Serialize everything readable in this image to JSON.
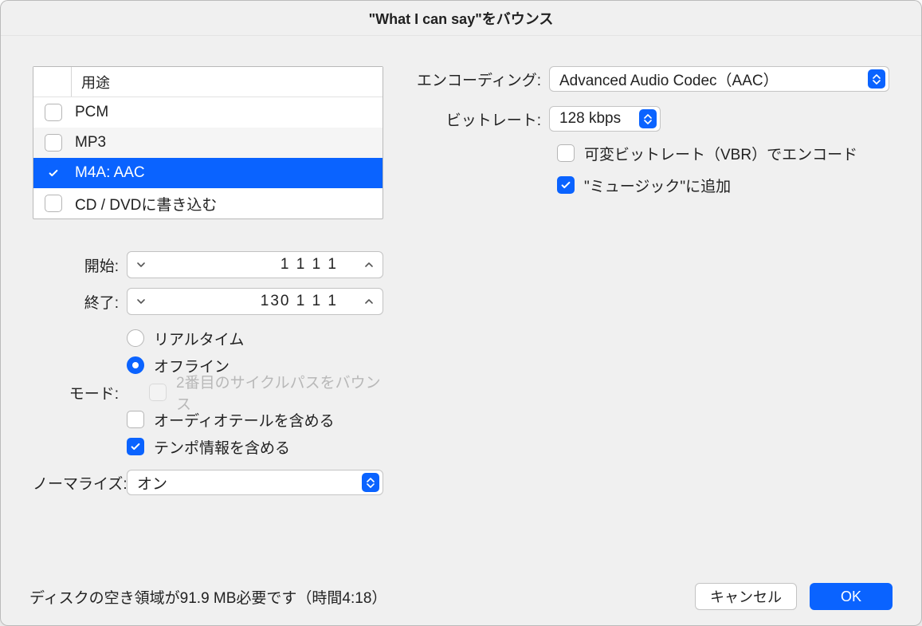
{
  "title": "\"What I can say\"をバウンス",
  "format_list": {
    "header": "用途",
    "items": [
      {
        "label": "PCM",
        "checked": false
      },
      {
        "label": "MP3",
        "checked": false
      },
      {
        "label": "M4A: AAC",
        "checked": true,
        "selected": true
      },
      {
        "label": "CD / DVDに書き込む",
        "checked": false
      }
    ]
  },
  "range": {
    "start_label": "開始:",
    "end_label": "終了:",
    "start_value": "1  1  1      1",
    "end_value": "130  1  1      1"
  },
  "mode": {
    "label": "モード:",
    "realtime": "リアルタイム",
    "offline": "オフライン",
    "second_pass": "2番目のサイクルパスをバウンス",
    "include_tail": "オーディオテールを含める",
    "include_tempo": "テンポ情報を含める",
    "selected": "offline",
    "include_tempo_checked": true,
    "include_tail_checked": false
  },
  "normalize": {
    "label": "ノーマライズ:",
    "value": "オン"
  },
  "encoding": {
    "label": "エンコーディング:",
    "value": "Advanced Audio Codec（AAC）"
  },
  "bitrate": {
    "label": "ビットレート:",
    "value": "128 kbps"
  },
  "options": {
    "vbr_label": "可変ビットレート（VBR）でエンコード",
    "vbr_checked": false,
    "add_music_label": "\"ミュージック\"に追加",
    "add_music_checked": true
  },
  "footer": {
    "disk": "ディスクの空き領域が91.9 MB必要です（時間4:18）",
    "cancel": "キャンセル",
    "ok": "OK"
  }
}
